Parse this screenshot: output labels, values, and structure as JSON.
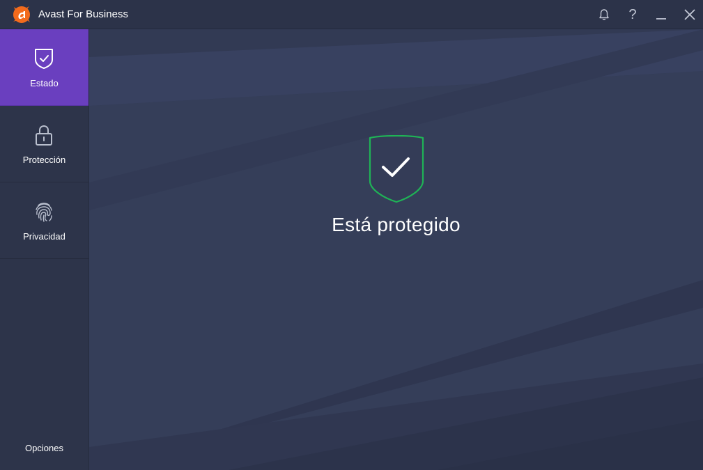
{
  "window": {
    "title": "Avast For Business"
  },
  "titlebar": {
    "icons": [
      "bell-icon",
      "help-icon",
      "minimize-icon",
      "close-icon"
    ],
    "help_glyph": "?"
  },
  "sidebar": {
    "items": [
      {
        "label": "Estado",
        "icon": "shield-check-icon",
        "active": true
      },
      {
        "label": "Protección",
        "icon": "lock-icon",
        "active": false
      },
      {
        "label": "Privacidad",
        "icon": "fingerprint-icon",
        "active": false
      }
    ],
    "options_label": "Opciones"
  },
  "main": {
    "status_text": "Está protegido",
    "status_icon": "shield-check-icon"
  },
  "colors": {
    "accent": "#6a3fbf",
    "brand": "#f26b1d",
    "status_ok": "#1fb356",
    "background": "#343c57"
  }
}
